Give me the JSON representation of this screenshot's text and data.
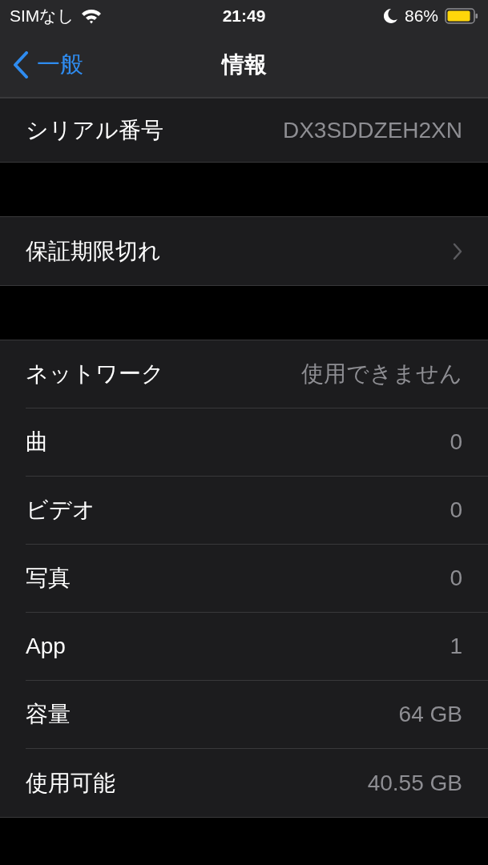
{
  "status_bar": {
    "carrier": "SIMなし",
    "time": "21:49",
    "battery": "86%"
  },
  "nav": {
    "back": "一般",
    "title": "情報"
  },
  "groups": [
    {
      "rows": [
        {
          "kind": "value",
          "label": "シリアル番号",
          "value": "DX3SDDZEH2XN"
        }
      ]
    },
    {
      "rows": [
        {
          "kind": "link",
          "label": "保証期限切れ"
        }
      ]
    },
    {
      "rows": [
        {
          "kind": "value",
          "label": "ネットワーク",
          "value": "使用できません"
        },
        {
          "kind": "value",
          "label": "曲",
          "value": "0"
        },
        {
          "kind": "value",
          "label": "ビデオ",
          "value": "0"
        },
        {
          "kind": "value",
          "label": "写真",
          "value": "0"
        },
        {
          "kind": "value",
          "label": "App",
          "value": "1"
        },
        {
          "kind": "value",
          "label": "容量",
          "value": "64 GB"
        },
        {
          "kind": "value",
          "label": "使用可能",
          "value": "40.55 GB"
        }
      ]
    }
  ]
}
